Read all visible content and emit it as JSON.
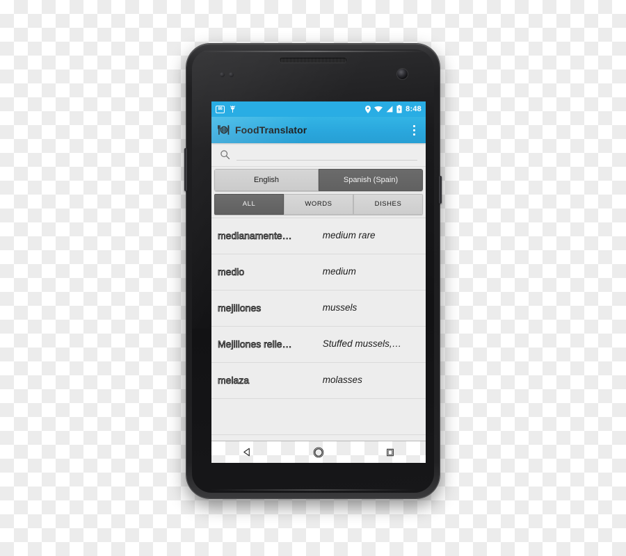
{
  "device": {
    "name": "android-smartphone",
    "frame_color": "#1d1d1f"
  },
  "status_bar": {
    "background": "#29ade4",
    "left_icons": [
      {
        "name": "notification-badge-icon",
        "label": "86"
      },
      {
        "name": "android-debug-icon",
        "label": ""
      }
    ],
    "right_icons": [
      {
        "name": "location-pin-icon"
      },
      {
        "name": "wifi-icon"
      },
      {
        "name": "cellular-signal-icon"
      },
      {
        "name": "battery-charging-icon"
      }
    ],
    "clock": "8:48"
  },
  "action_bar": {
    "background": "#33b5e5",
    "app_icon": "food-translator-icon",
    "title": "FoodTranslator",
    "overflow_icon": "overflow-menu-icon"
  },
  "search": {
    "icon": "search-icon",
    "value": "",
    "placeholder": ""
  },
  "language_selector": {
    "options": [
      {
        "label": "English",
        "selected": false
      },
      {
        "label": "Spanish (Spain)",
        "selected": true
      }
    ]
  },
  "filter_tabs": {
    "items": [
      {
        "label": "ALL",
        "selected": true
      },
      {
        "label": "WORDS",
        "selected": false
      },
      {
        "label": "DISHES",
        "selected": false
      }
    ]
  },
  "results": {
    "rows": [
      {
        "term": "medianamente…",
        "translation": "medium rare"
      },
      {
        "term": "medio",
        "translation": "medium"
      },
      {
        "term": "mejillones",
        "translation": "mussels"
      },
      {
        "term": "Mejillones relle…",
        "translation": "Stuffed mussels,…"
      },
      {
        "term": "melaza",
        "translation": "molasses"
      }
    ]
  },
  "nav_bar": {
    "buttons": [
      {
        "name": "back-button",
        "icon": "back-triangle-icon"
      },
      {
        "name": "home-button",
        "icon": "home-circle-icon"
      },
      {
        "name": "recents-button",
        "icon": "recents-square-icon"
      }
    ]
  }
}
